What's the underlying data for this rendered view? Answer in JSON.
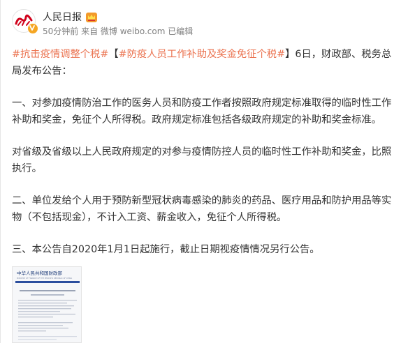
{
  "post": {
    "author": "人民日报",
    "meta": "50分钟前 来自 微博 weibo.com 已编辑",
    "tag1": "#抗击疫情调整个税#",
    "tag2": "#防疫人员工作补助及奖金免征个税#",
    "lead_before_tag2": "【",
    "lead_after": "】6日，财政部、税务总局发布公告：",
    "p1": "一、对参加疫情防治工作的医务人员和防疫工作者按照政府规定标准取得的临时性工作补助和奖金，免征个人所得税。政府规定标准包括各级政府规定的补助和奖金标准。",
    "p2": "对省级及省级以上人民政府规定的对参与疫情防控人员的临时性工作补助和奖金，比照执行。",
    "p3": "二、单位发给个人用于预防新型冠状病毒感染的肺炎的药品、医疗用品和防护用品等实物（不包括现金），不计入工资、薪金收入，免征个人所得税。",
    "p4": "三、本公告自2020年1月1日起施行，截止日期视疫情情况另行公告。"
  },
  "icons": {
    "avatar": "avatar-logo",
    "verified": "verified-badge-icon",
    "crown": "crown-icon"
  },
  "colors": {
    "tag": "#eb7350",
    "meta": "#808080",
    "text": "#333333"
  },
  "thumbnail": {
    "header": "中华人民共和国财政部",
    "subheader": "MINISTRY OF FINANCE OF THE PEOPLE'S REPUBLIC OF CHINA"
  }
}
